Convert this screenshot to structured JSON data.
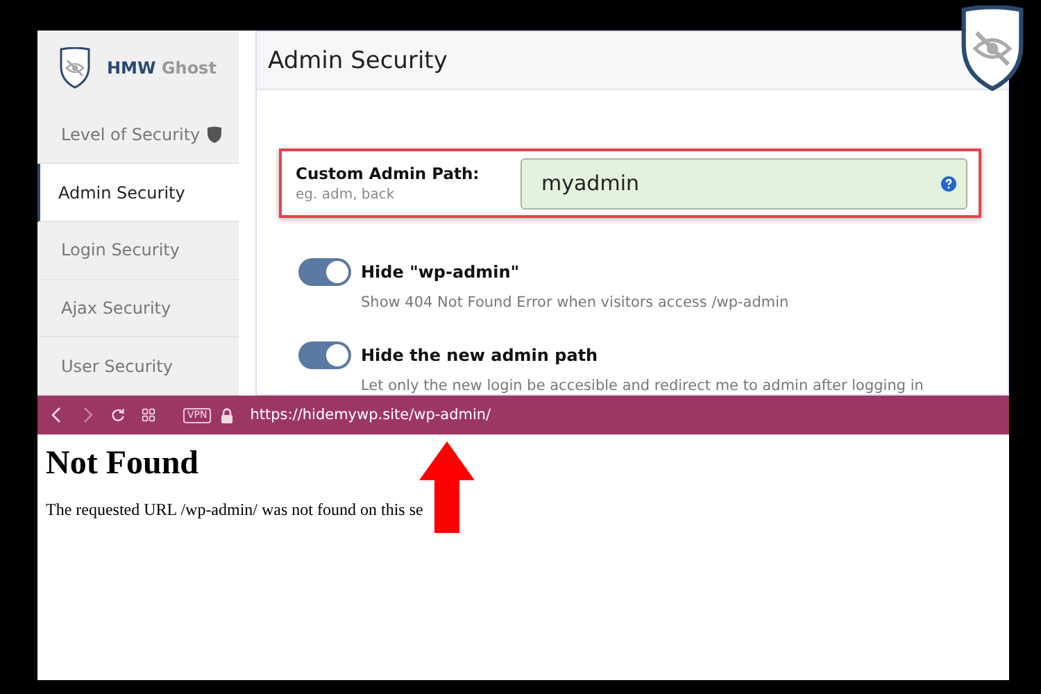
{
  "brand": {
    "name_strong": "HMW",
    "name_rest": "Ghost"
  },
  "sidebar": {
    "items": [
      {
        "label": "Level of Security",
        "selected": false,
        "shield": true
      },
      {
        "label": "Admin Security",
        "selected": true,
        "shield": false
      },
      {
        "label": "Login Security",
        "selected": false,
        "shield": false
      },
      {
        "label": "Ajax Security",
        "selected": false,
        "shield": false
      },
      {
        "label": "User Security",
        "selected": false,
        "shield": false
      }
    ]
  },
  "panel": {
    "title": "Admin Security",
    "path_setting": {
      "label": "Custom Admin Path:",
      "hint": "eg. adm, back",
      "value": "myadmin",
      "highlighted": true
    },
    "toggles": [
      {
        "label": "Hide \"wp-admin\"",
        "description": "Show 404 Not Found Error when visitors access /wp-admin",
        "on": true
      },
      {
        "label": "Hide the new admin path",
        "description": "Let only the new login be accesible and redirect me to admin after logging in",
        "on": true
      }
    ]
  },
  "browser": {
    "vpn": "VPN",
    "url": "https://hidemywp.site/wp-admin/",
    "forward_disabled": true
  },
  "error_page": {
    "heading": "Not Found",
    "message": "The requested URL /wp-admin/ was not found on this se"
  }
}
